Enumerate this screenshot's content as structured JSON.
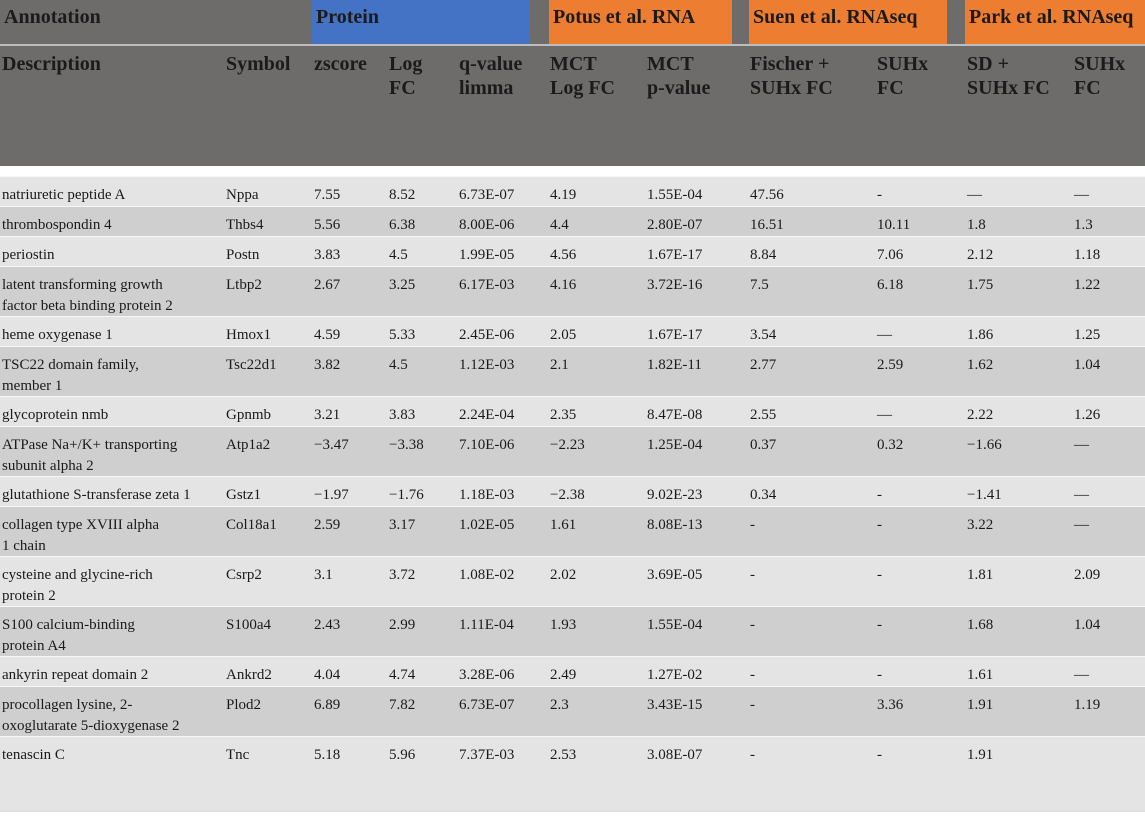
{
  "groups": {
    "annotation": "Annotation",
    "protein": "Protein",
    "potus": "Potus et al. RNA",
    "suen": "Suen et al. RNAseq",
    "park": "Park et al. RNAseq"
  },
  "columns": {
    "description": "Description",
    "symbol": "Symbol",
    "zscore": "zscore",
    "logfc": "Log\nFC",
    "qvalue": "q-value\nlimma",
    "mct_logfc": "MCT\nLog FC",
    "mct_pvalue": "MCT\np-value",
    "suen_fischer": "Fischer +\nSUHx FC",
    "suen_suhx": "SUHx\nFC",
    "park_sd": "SD +\nSUHx FC",
    "park_suhx": "SUHx\nFC"
  },
  "rows": [
    {
      "desc": "natriuretic peptide A",
      "sym": "Nppa",
      "z": "7.55",
      "lfc": "8.52",
      "q": "6.73E-07",
      "mlfc": "4.19",
      "mp": "1.55E-04",
      "sf": "47.56",
      "ss": "-",
      "psd": "—",
      "ps": "—"
    },
    {
      "desc": "thrombospondin 4",
      "sym": "Thbs4",
      "z": "5.56",
      "lfc": "6.38",
      "q": "8.00E-06",
      "mlfc": "4.4",
      "mp": "2.80E-07",
      "sf": "16.51",
      "ss": "10.11",
      "psd": "1.8",
      "ps": "1.3"
    },
    {
      "desc": "periostin",
      "sym": "Postn",
      "z": "3.83",
      "lfc": "4.5",
      "q": "1.99E-05",
      "mlfc": "4.56",
      "mp": "1.67E-17",
      "sf": "8.84",
      "ss": "7.06",
      "psd": "2.12",
      "ps": "1.18"
    },
    {
      "desc": "latent transforming growth\nfactor beta binding protein 2",
      "sym": "Ltbp2",
      "z": "2.67",
      "lfc": "3.25",
      "q": "6.17E-03",
      "mlfc": "4.16",
      "mp": "3.72E-16",
      "sf": "7.5",
      "ss": "6.18",
      "psd": "1.75",
      "ps": "1.22"
    },
    {
      "desc": "heme oxygenase 1",
      "sym": "Hmox1",
      "z": "4.59",
      "lfc": "5.33",
      "q": "2.45E-06",
      "mlfc": "2.05",
      "mp": "1.67E-17",
      "sf": "3.54",
      "ss": "—",
      "psd": "1.86",
      "ps": "1.25"
    },
    {
      "desc": "TSC22 domain family,\nmember 1",
      "sym": "Tsc22d1",
      "z": "3.82",
      "lfc": "4.5",
      "q": "1.12E-03",
      "mlfc": "2.1",
      "mp": "1.82E-11",
      "sf": "2.77",
      "ss": "2.59",
      "psd": "1.62",
      "ps": "1.04"
    },
    {
      "desc": "glycoprotein nmb",
      "sym": "Gpnmb",
      "z": "3.21",
      "lfc": "3.83",
      "q": "2.24E-04",
      "mlfc": "2.35",
      "mp": "8.47E-08",
      "sf": "2.55",
      "ss": "—",
      "psd": "2.22",
      "ps": "1.26"
    },
    {
      "desc": "ATPase Na+/K+ transporting\nsubunit alpha 2",
      "sym": "Atp1a2",
      "z": "−3.47",
      "lfc": "−3.38",
      "q": "7.10E-06",
      "mlfc": "−2.23",
      "mp": "1.25E-04",
      "sf": "0.37",
      "ss": "0.32",
      "psd": "−1.66",
      "ps": "—"
    },
    {
      "desc": "glutathione S-transferase zeta 1",
      "sym": "Gstz1",
      "z": "−1.97",
      "lfc": "−1.76",
      "q": "1.18E-03",
      "mlfc": "−2.38",
      "mp": "9.02E-23",
      "sf": "0.34",
      "ss": "-",
      "psd": "−1.41",
      "ps": "—"
    },
    {
      "desc": "collagen type XVIII alpha\n1 chain",
      "sym": "Col18a1",
      "z": "2.59",
      "lfc": "3.17",
      "q": "1.02E-05",
      "mlfc": "1.61",
      "mp": "8.08E-13",
      "sf": "-",
      "ss": "-",
      "psd": "3.22",
      "ps": "—"
    },
    {
      "desc": "cysteine and glycine-rich\nprotein 2",
      "sym": "Csrp2",
      "z": "3.1",
      "lfc": "3.72",
      "q": "1.08E-02",
      "mlfc": "2.02",
      "mp": "3.69E-05",
      "sf": "-",
      "ss": "-",
      "psd": "1.81",
      "ps": "2.09"
    },
    {
      "desc": "S100 calcium-binding\nprotein A4",
      "sym": "S100a4",
      "z": "2.43",
      "lfc": "2.99",
      "q": "1.11E-04",
      "mlfc": "1.93",
      "mp": "1.55E-04",
      "sf": "-",
      "ss": "-",
      "psd": "1.68",
      "ps": "1.04"
    },
    {
      "desc": "ankyrin repeat domain 2",
      "sym": "Ankrd2",
      "z": "4.04",
      "lfc": "4.74",
      "q": "3.28E-06",
      "mlfc": "2.49",
      "mp": "1.27E-02",
      "sf": "-",
      "ss": "-",
      "psd": "1.61",
      "ps": "—"
    },
    {
      "desc": "procollagen lysine, 2-\noxoglutarate 5-dioxygenase 2",
      "sym": "Plod2",
      "z": "6.89",
      "lfc": "7.82",
      "q": "6.73E-07",
      "mlfc": "2.3",
      "mp": "3.43E-15",
      "sf": "-",
      "ss": "3.36",
      "psd": "1.91",
      "ps": "1.19"
    },
    {
      "desc": "tenascin C",
      "sym": "Tnc",
      "z": "5.18",
      "lfc": "5.96",
      "q": "7.37E-03",
      "mlfc": "2.53",
      "mp": "3.08E-07",
      "sf": "-",
      "ss": "-",
      "psd": "1.91",
      "ps": ""
    }
  ],
  "colors": {
    "header_gray": "#6e6b6b",
    "protein_blue": "#4472c4",
    "rna_orange": "#ed7d31",
    "row_light": "#e4e4e4",
    "row_dark": "#cfcfcf"
  }
}
